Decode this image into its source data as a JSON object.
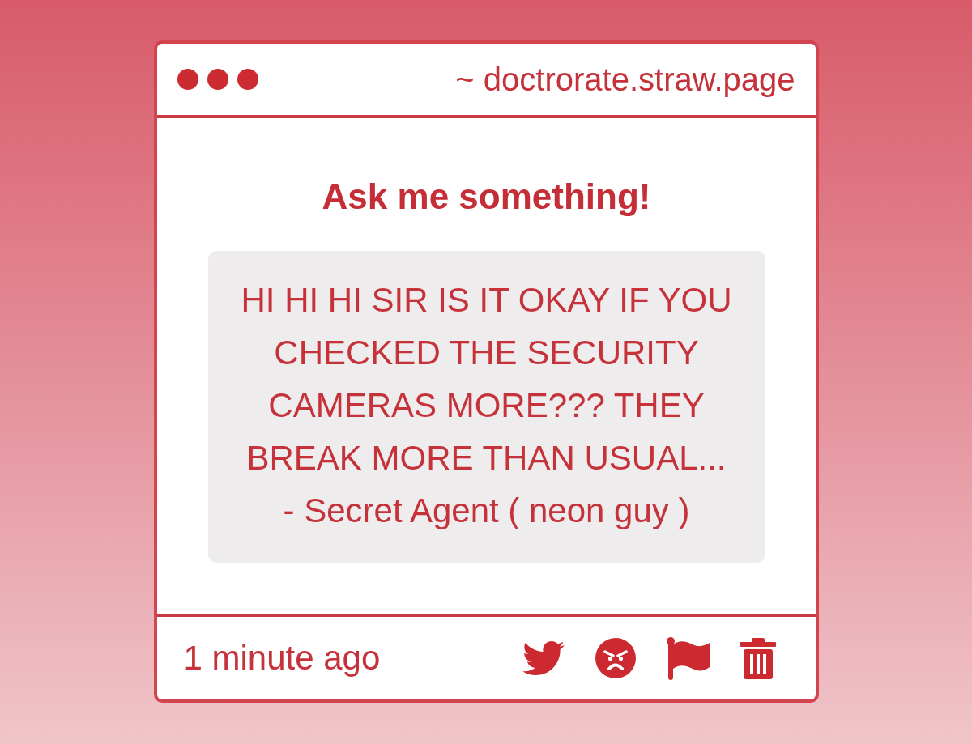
{
  "window": {
    "url": "~ doctrorate.straw.page"
  },
  "prompt": {
    "title": "Ask me something!"
  },
  "message": {
    "text": "HI HI HI SIR IS IT OKAY IF YOU CHECKED THE SECURITY CAMERAS MORE??? THEY BREAK MORE THAN USUAL...",
    "signature": "- Secret Agent ( neon guy )"
  },
  "footer": {
    "time": "1 minute ago",
    "actions": [
      {
        "kind": "share"
      },
      {
        "kind": "react"
      },
      {
        "kind": "report"
      },
      {
        "kind": "delete"
      }
    ]
  }
}
